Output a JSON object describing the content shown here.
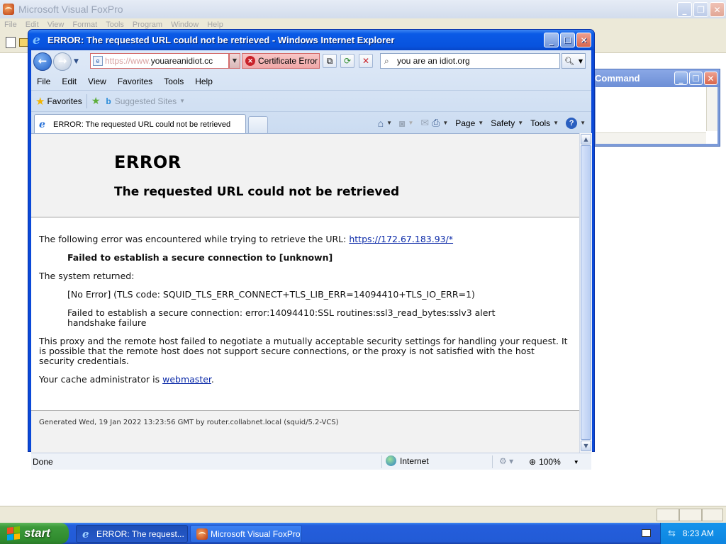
{
  "vfp": {
    "title": "Microsoft Visual FoxPro",
    "menu": [
      "File",
      "Edit",
      "View",
      "Format",
      "Tools",
      "Program",
      "Window",
      "Help"
    ],
    "command_window_title": "Command"
  },
  "ie": {
    "window_title": "ERROR: The requested URL could not be retrieved - Windows Internet Explorer",
    "address": {
      "protocol": "https://www.",
      "host": "youareanidiot.cc"
    },
    "cert_error_label": "Certificate Error",
    "search_value": "you are an idiot.org",
    "menu": [
      "File",
      "Edit",
      "View",
      "Favorites",
      "Tools",
      "Help"
    ],
    "favorites_label": "Favorites",
    "suggested_sites_label": "Suggested Sites",
    "tab_title": "ERROR: The requested URL could not be retrieved",
    "command_bar": {
      "page": "Page",
      "safety": "Safety",
      "tools": "Tools"
    },
    "status": {
      "done": "Done",
      "zone": "Internet",
      "zoom": "100%"
    }
  },
  "page": {
    "heading": "ERROR",
    "subheading": "The requested URL could not be retrieved",
    "intro": "The following error was encountered while trying to retrieve the URL: ",
    "url": "https://172.67.183.93/*",
    "failed_bold": "Failed to establish a secure connection to [unknown]",
    "system_returned": "The system returned:",
    "tls_error": "[No Error] (TLS code: SQUID_TLS_ERR_CONNECT+TLS_LIB_ERR=14094410+TLS_IO_ERR=1)",
    "ssl_error": "Failed to establish a secure connection: error:14094410:SSL routines:ssl3_read_bytes:sslv3 alert handshake failure",
    "explanation": "This proxy and the remote host failed to negotiate a mutually acceptable security settings for handling your request. It is possible that the remote host does not support secure connections, or the proxy is not satisfied with the host security credentials.",
    "admin_prefix": "Your cache administrator is ",
    "admin_link": "webmaster",
    "admin_suffix": ".",
    "footer": "Generated Wed, 19 Jan 2022 13:23:56 GMT by router.collabnet.local (squid/5.2-VCS)"
  },
  "taskbar": {
    "start_label": "start",
    "tasks": [
      "ERROR: The request...",
      "Microsoft Visual FoxPro"
    ],
    "clock": "8:23 AM"
  },
  "colors": {
    "xp_blue": "#0a49d8",
    "start_green": "#3c9a3a",
    "cert_error_red": "#f0a8a8",
    "link_blue": "#0b2aa8"
  }
}
